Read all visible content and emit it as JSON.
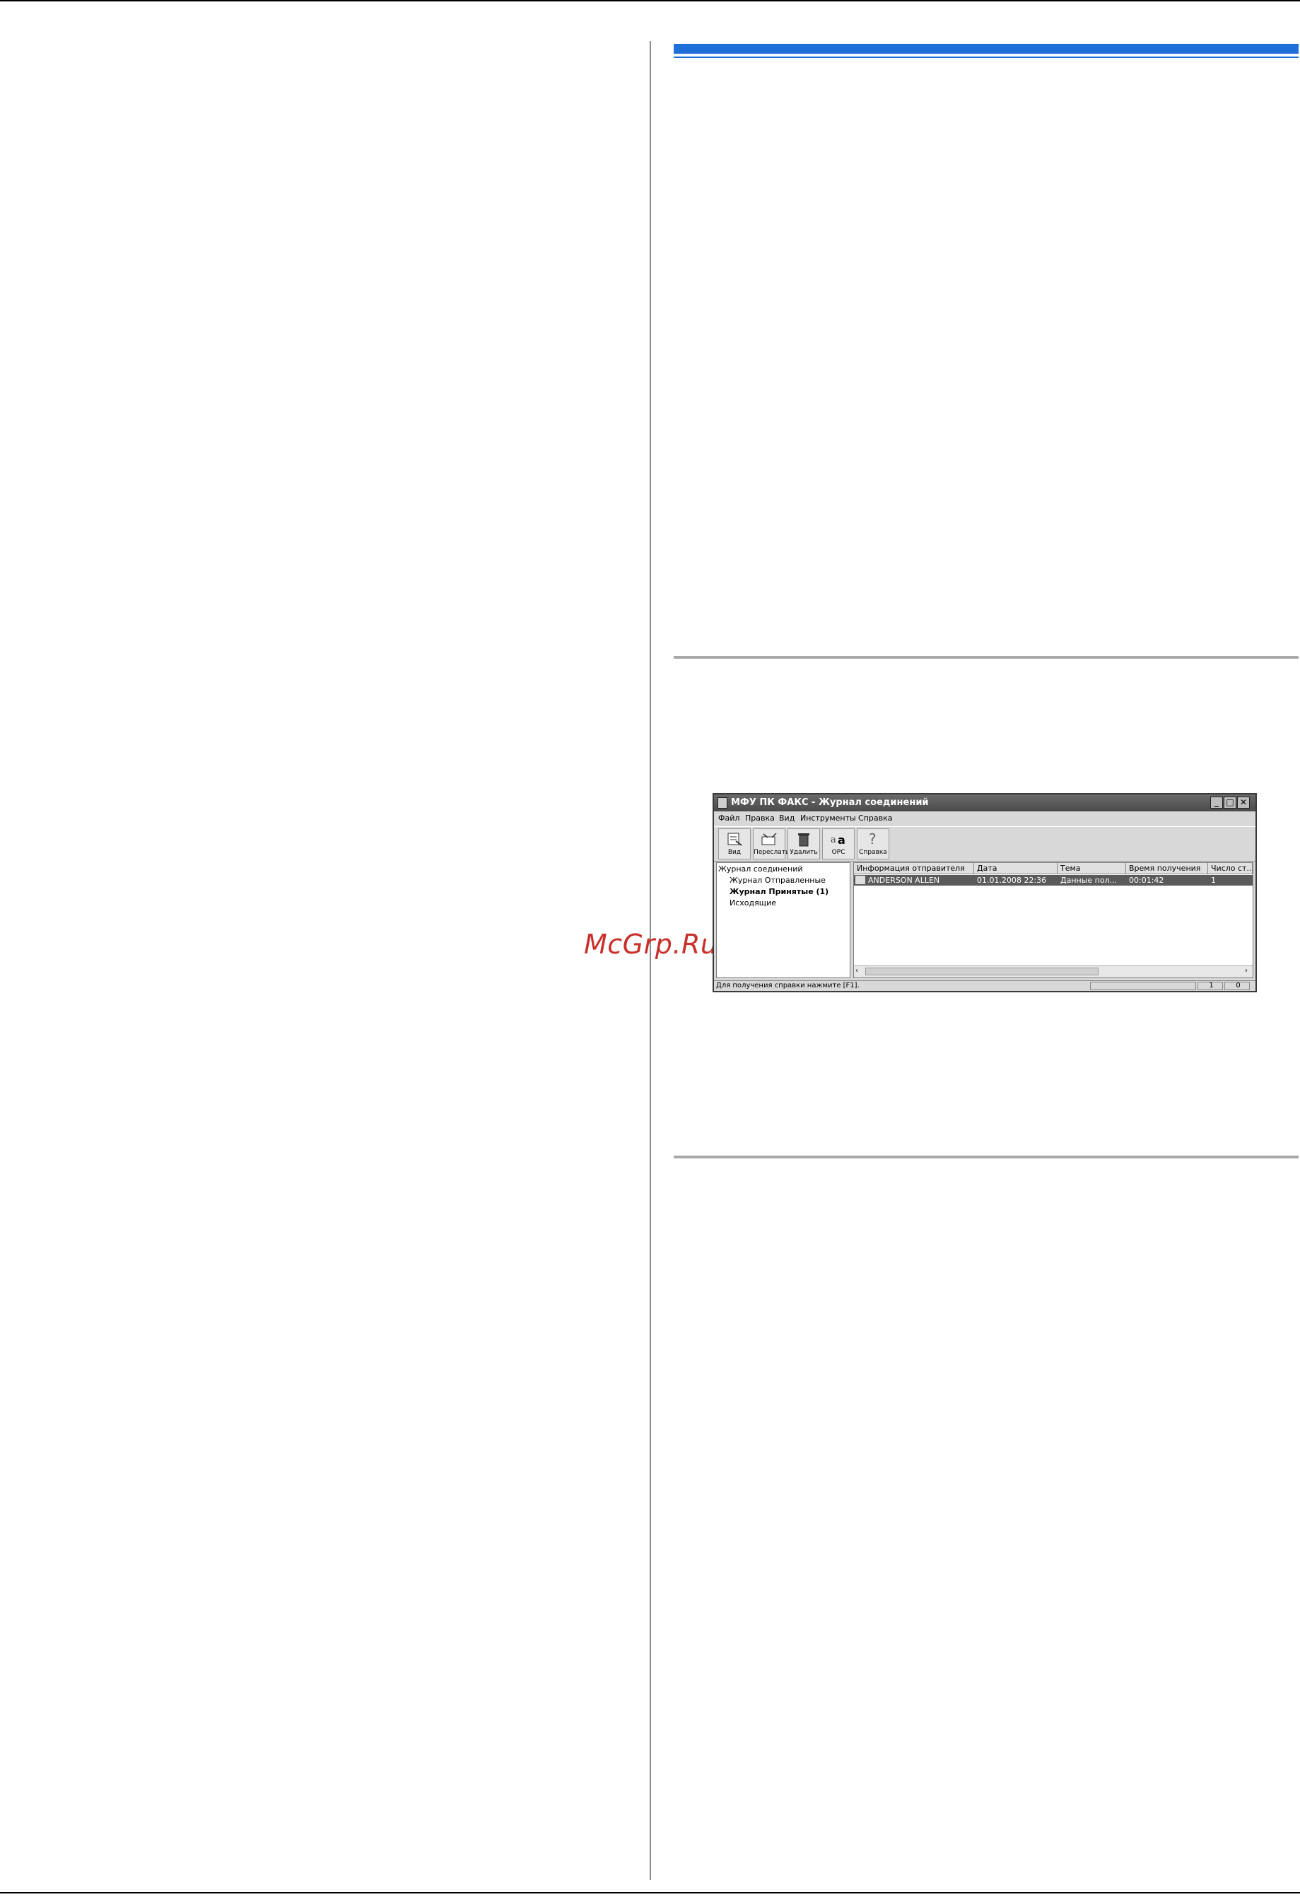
{
  "watermark": "McGrp.Ru",
  "window": {
    "title": "МФУ ПК ФАКС - Журнал соединений",
    "controls": [
      "minimize",
      "maximize",
      "close"
    ],
    "menu": [
      "Файл",
      "Правка",
      "Вид",
      "Инструменты",
      "Справка"
    ],
    "toolbar": [
      {
        "label": "Вид",
        "icon": "view-icon"
      },
      {
        "label": "Переслать",
        "icon": "forward-icon"
      },
      {
        "label": "Удалить",
        "icon": "delete-icon"
      },
      {
        "label": "OPC",
        "icon": "ocr-icon"
      },
      {
        "label": "Справка",
        "icon": "help-icon"
      }
    ],
    "tree": {
      "root": "Журнал соединений",
      "items": [
        "Журнал Отправленные",
        "Журнал Принятые (1)",
        "Исходящие"
      ]
    },
    "list": {
      "columns": [
        "Информация отправителя",
        "Дата",
        "Тема",
        "Время получения",
        "Число ст..."
      ],
      "rows": [
        [
          "ANDERSON ALLEN",
          "01.01.2008 22:36",
          "Данные пол...",
          "00:01:42",
          "1"
        ]
      ]
    },
    "status": {
      "hint": "Для получения справки нажмите [F1].",
      "count1": "1",
      "count2": "0"
    }
  }
}
